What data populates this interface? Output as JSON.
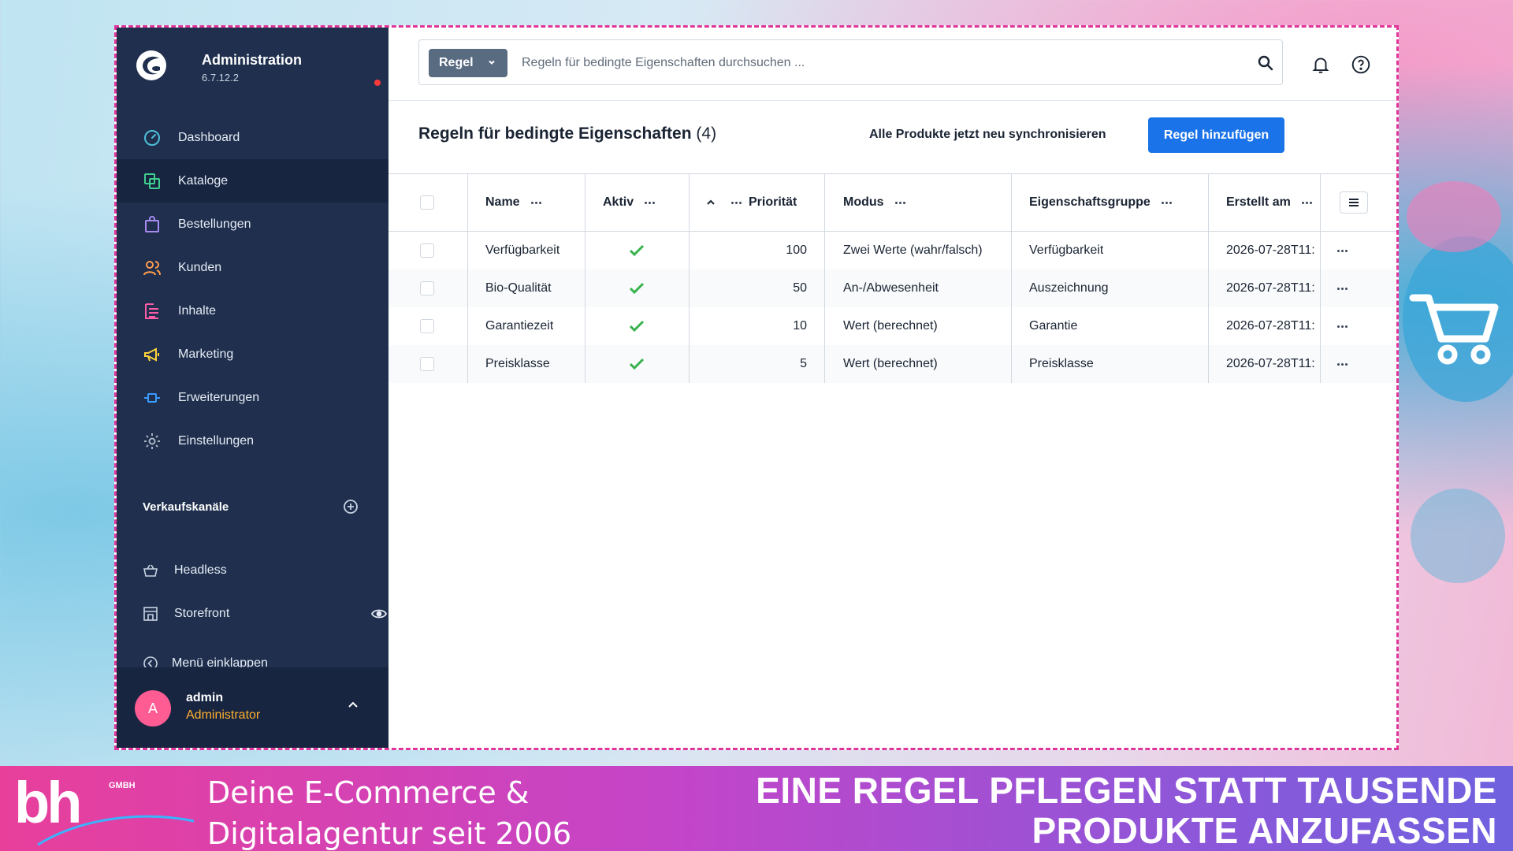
{
  "brand": {
    "title": "Administration",
    "version": "6.7.12.2"
  },
  "sidebar": {
    "items": [
      {
        "label": "Dashboard",
        "icon": "gauge-icon"
      },
      {
        "label": "Kataloge",
        "icon": "catalog-icon",
        "active": true
      },
      {
        "label": "Bestellungen",
        "icon": "shopping-bag-icon"
      },
      {
        "label": "Kunden",
        "icon": "users-icon"
      },
      {
        "label": "Inhalte",
        "icon": "content-icon"
      },
      {
        "label": "Marketing",
        "icon": "megaphone-icon"
      },
      {
        "label": "Erweiterungen",
        "icon": "plug-icon"
      },
      {
        "label": "Einstellungen",
        "icon": "gear-icon"
      }
    ],
    "sales_channels": {
      "title": "Verkaufskanäle",
      "items": [
        {
          "label": "Headless",
          "icon": "basket-icon"
        },
        {
          "label": "Storefront",
          "icon": "storefront-icon"
        }
      ]
    },
    "collapse_label": "Menü einklappen",
    "user": {
      "initial": "A",
      "name": "admin",
      "role": "Administrator"
    }
  },
  "search": {
    "type_label": "Regel",
    "placeholder": "Regeln für bedingte Eigenschaften durchsuchen ..."
  },
  "page": {
    "title": "Regeln für bedingte Eigenschaften",
    "count": "(4)",
    "sync_label": "Alle Produkte jetzt neu synchronisieren",
    "add_label": "Regel hinzufügen"
  },
  "table": {
    "columns": {
      "name": "Name",
      "active": "Aktiv",
      "priority": "Priorität",
      "mode": "Modus",
      "group": "Eigenschaftsgruppe",
      "created": "Erstellt am"
    },
    "rows": [
      {
        "name": "Verfügbarkeit",
        "active": true,
        "priority": "100",
        "mode": "Zwei Werte (wahr/falsch)",
        "group": "Verfügbarkeit",
        "created": "2026-07-28T11:"
      },
      {
        "name": "Bio-Qualität",
        "active": true,
        "priority": "50",
        "mode": "An-/Abwesenheit",
        "group": "Auszeichnung",
        "created": "2026-07-28T11:"
      },
      {
        "name": "Garantiezeit",
        "active": true,
        "priority": "10",
        "mode": "Wert (berechnet)",
        "group": "Garantie",
        "created": "2026-07-28T11:"
      },
      {
        "name": "Preisklasse",
        "active": true,
        "priority": "5",
        "mode": "Wert (berechnet)",
        "group": "Preisklasse",
        "created": "2026-07-28T11:"
      }
    ]
  },
  "banner": {
    "logo_text": "bh",
    "logo_sub": "GMBH",
    "slogan_line1": "Deine E-Commerce &",
    "slogan_line2": "Digitalagentur seit 2006",
    "headline_line1": "EINE REGEL PFLEGEN STATT TAUSENDE",
    "headline_line2": "PRODUKTE ANZUFASSEN"
  },
  "colors": {
    "sidebar": "#1f2f4d",
    "accent": "#1a73e8",
    "check": "#37b24d",
    "role": "#ffb02e",
    "frame_border": "#e0359a"
  }
}
